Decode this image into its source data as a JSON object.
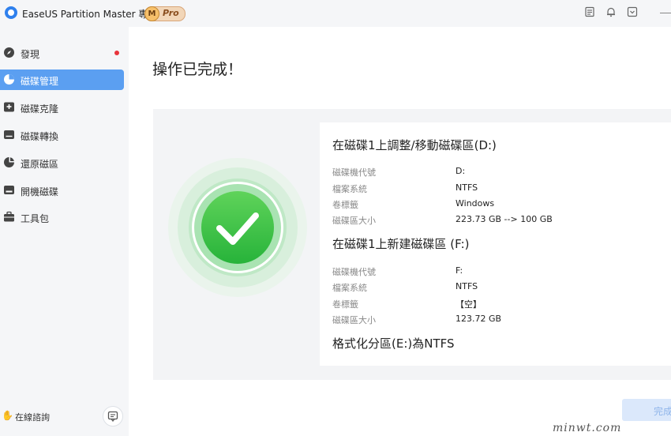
{
  "window": {
    "title": "EaseUS Partition Master 專業版",
    "badge_letter": "M",
    "badge_text": "Pro"
  },
  "sidebar": {
    "items": [
      {
        "label": "發現",
        "icon": "compass-icon",
        "active": false,
        "has_dot": true
      },
      {
        "label": "磁碟管理",
        "icon": "pie-chart-icon",
        "active": true,
        "has_dot": false
      },
      {
        "label": "磁碟克隆",
        "icon": "disk-clone-icon",
        "active": false,
        "has_dot": false
      },
      {
        "label": "磁碟轉換",
        "icon": "disk-convert-icon",
        "active": false,
        "has_dot": false
      },
      {
        "label": "還原磁區",
        "icon": "partition-recovery-icon",
        "active": false,
        "has_dot": false
      },
      {
        "label": "開機磁碟",
        "icon": "boot-disk-icon",
        "active": false,
        "has_dot": false
      },
      {
        "label": "工具包",
        "icon": "toolbox-icon",
        "active": false,
        "has_dot": false
      }
    ],
    "chat_label": "在線諮詢"
  },
  "main": {
    "page_title": "操作已完成！",
    "operations": [
      {
        "title": "在磁碟1上調整/移動磁碟區(D:)",
        "rows": [
          {
            "label": "磁碟機代號",
            "value": "D:"
          },
          {
            "label": "檔案系統",
            "value": "NTFS"
          },
          {
            "label": "卷標籤",
            "value": "Windows"
          },
          {
            "label": "磁碟區大小",
            "value": "223.73 GB --> 100 GB"
          }
        ]
      },
      {
        "title": "在磁碟1上新建磁碟區   (F:)",
        "rows": [
          {
            "label": "磁碟機代號",
            "value": "F:"
          },
          {
            "label": "檔案系統",
            "value": "NTFS"
          },
          {
            "label": "卷標籤",
            "value": "【空】"
          },
          {
            "label": "磁碟區大小",
            "value": "123.72 GB"
          }
        ]
      },
      {
        "title": "格式化分區(E:)為NTFS",
        "rows": []
      }
    ],
    "done_label": "完成"
  },
  "watermark": "minwt.com",
  "colors": {
    "accent": "#5b9ff1",
    "success": "#3cc43c",
    "alert_dot": "#e8343c"
  }
}
